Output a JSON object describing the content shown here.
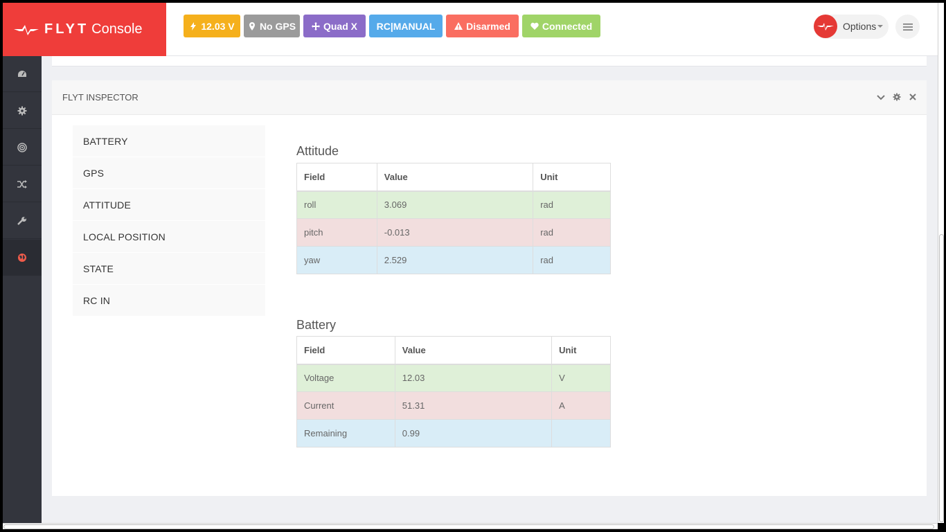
{
  "brand": {
    "flyt": "FLYT",
    "console": "Console"
  },
  "status_bar": {
    "voltage": {
      "label": "12.03 V",
      "color": "#f5b01c",
      "icon": "bolt-icon"
    },
    "gps": {
      "label": "No GPS",
      "color": "#9b9b9b",
      "icon": "map-marker-icon"
    },
    "frame": {
      "label": "Quad X",
      "color": "#8b6cc8",
      "icon": "arrows-icon"
    },
    "rc": {
      "label": "RC|MANUAL",
      "color": "#55aaea"
    },
    "arm": {
      "label": "Disarmed",
      "color": "#fa6e61",
      "icon": "warning-icon"
    },
    "link": {
      "label": "Connected",
      "color": "#a0d468",
      "icon": "heart-icon"
    }
  },
  "header": {
    "options_label": "Options"
  },
  "sidebar": {
    "items": [
      {
        "name": "dashboard",
        "icon": "dashboard-icon"
      },
      {
        "name": "settings",
        "icon": "gear-icon"
      },
      {
        "name": "target",
        "icon": "target-icon"
      },
      {
        "name": "shuffle",
        "icon": "shuffle-icon"
      },
      {
        "name": "tools",
        "icon": "wrench-icon"
      },
      {
        "name": "globe",
        "icon": "globe-icon",
        "active": true
      }
    ]
  },
  "panel": {
    "title": "FLYT INSPECTOR"
  },
  "inspector_nav": [
    "BATTERY",
    "GPS",
    "ATTITUDE",
    "LOCAL POSITION",
    "STATE",
    "RC IN"
  ],
  "attitude": {
    "title": "Attitude",
    "headers": [
      "Field",
      "Value",
      "Unit"
    ],
    "rows": [
      {
        "field": "roll",
        "value": "3.069",
        "unit": "rad"
      },
      {
        "field": "pitch",
        "value": "-0.013",
        "unit": "rad"
      },
      {
        "field": "yaw",
        "value": "2.529",
        "unit": "rad"
      }
    ]
  },
  "battery": {
    "title": "Battery",
    "headers": [
      "Field",
      "Value",
      "Unit"
    ],
    "rows": [
      {
        "field": "Voltage",
        "value": "12.03",
        "unit": "V"
      },
      {
        "field": "Current",
        "value": "51.31",
        "unit": "A"
      },
      {
        "field": "Remaining",
        "value": "0.99",
        "unit": ""
      }
    ]
  }
}
